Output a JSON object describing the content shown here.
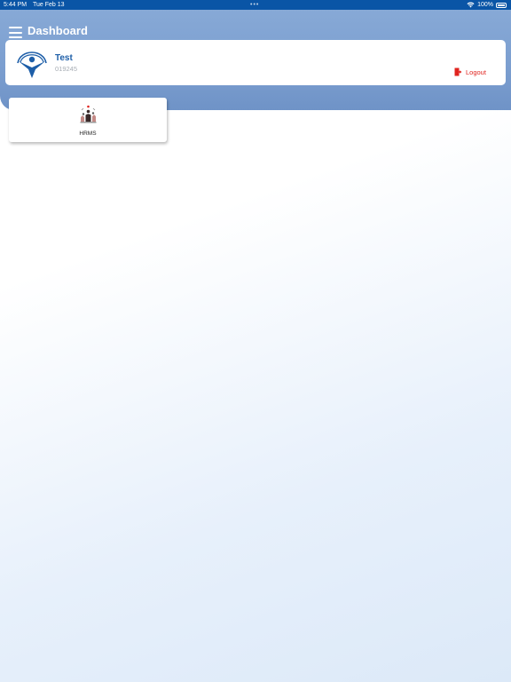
{
  "status_bar": {
    "time": "5:44 PM",
    "date": "Tue Feb 13",
    "dots": "•••",
    "battery": "100%",
    "icons": [
      "wifi-icon",
      "battery-icon"
    ]
  },
  "header": {
    "title": "Dashboard",
    "menu_icon": "hamburger-menu-icon",
    "background_color": "#7c9fd0",
    "status_color": "#0a55a6"
  },
  "profile": {
    "name": "Test",
    "employee_id": "019245",
    "logo_icon": "company-logo-icon",
    "logout_label": "Logout",
    "logout_icon": "logout-door-icon",
    "name_color": "#1d5ea8",
    "logout_color": "#e0241f"
  },
  "modules": [
    {
      "label": "HRMS",
      "icon": "hrms-people-icon"
    }
  ]
}
